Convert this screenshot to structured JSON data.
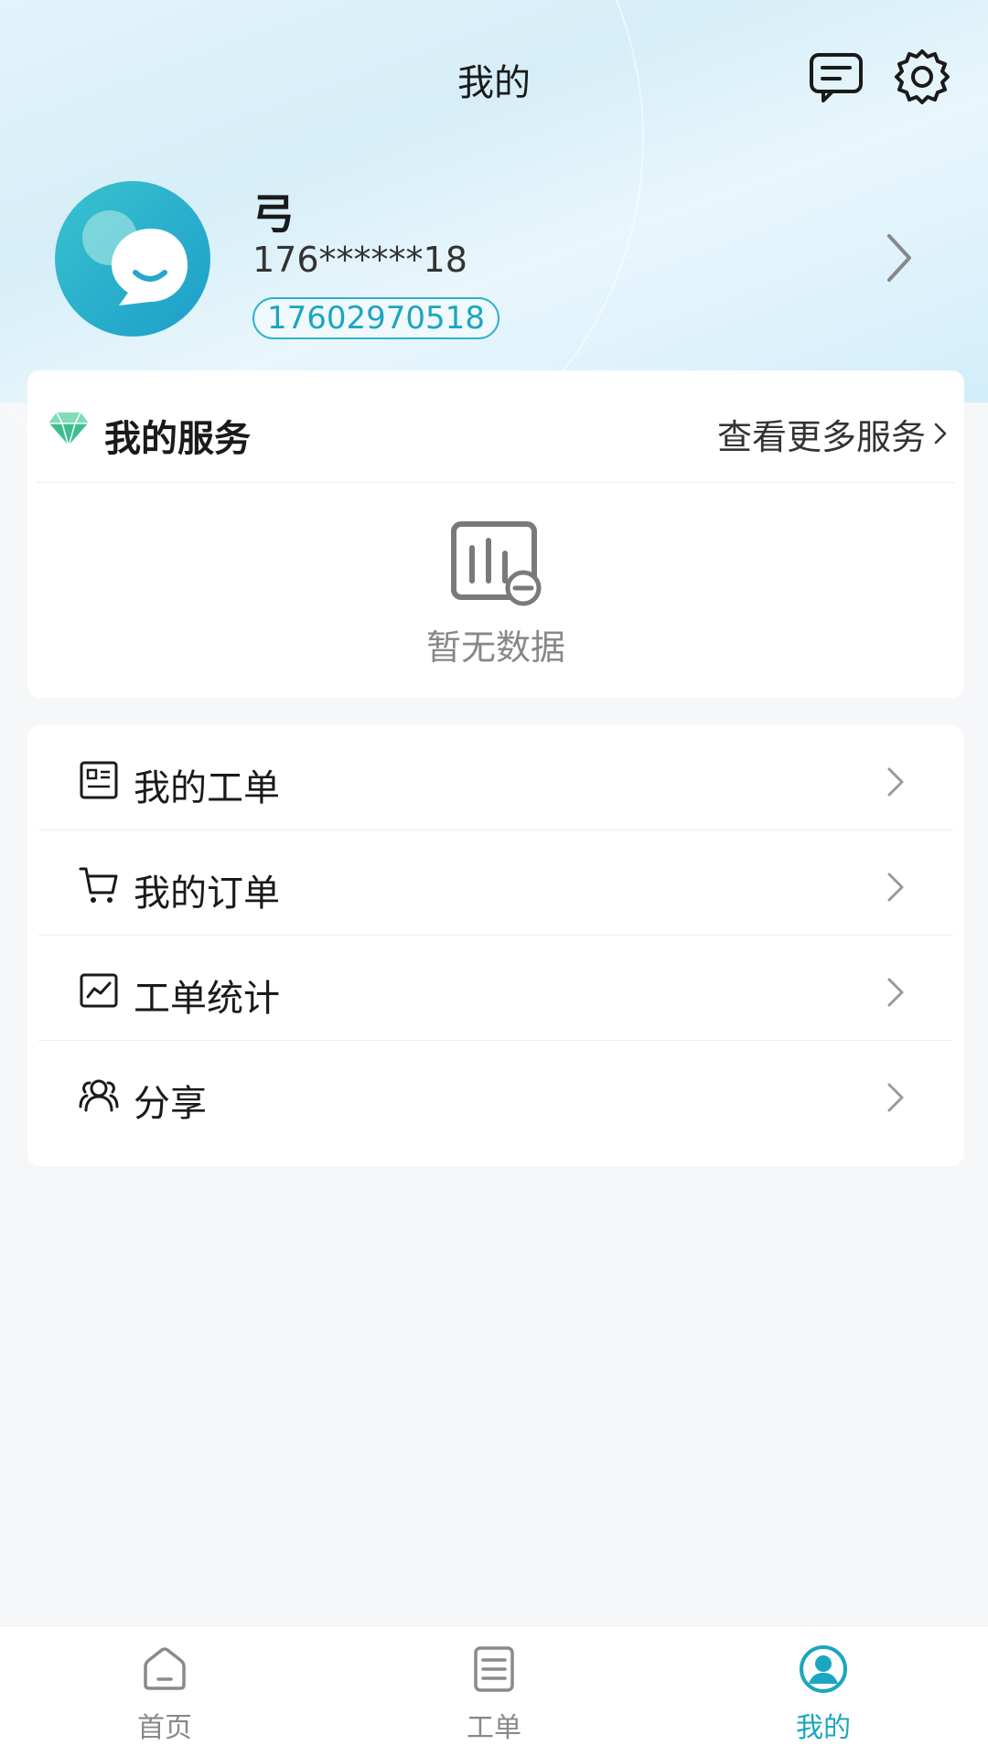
{
  "header": {
    "title": "我的",
    "message_icon": "message-icon",
    "settings_icon": "gear-icon"
  },
  "profile": {
    "name": "弓",
    "masked_phone": "176******18",
    "account_badge": "17602970518",
    "avatar_icon": "chat-bubble-avatar"
  },
  "services": {
    "title": "我的服务",
    "more_label": "查看更多服务",
    "empty_text": "暂无数据",
    "title_icon": "diamond-icon",
    "empty_icon": "no-data-chart-icon"
  },
  "menu": {
    "items": [
      {
        "label": "我的工单",
        "icon": "ticket-icon"
      },
      {
        "label": "我的订单",
        "icon": "cart-icon"
      },
      {
        "label": "工单统计",
        "icon": "stats-chart-icon"
      },
      {
        "label": "分享",
        "icon": "share-people-icon"
      }
    ]
  },
  "tabbar": {
    "tabs": [
      {
        "label": "首页",
        "icon": "home-icon",
        "active": false
      },
      {
        "label": "工单",
        "icon": "document-icon",
        "active": false
      },
      {
        "label": "我的",
        "icon": "profile-icon",
        "active": true
      }
    ]
  },
  "colors": {
    "accent": "#1aa6c0",
    "diamond": "#3cbf8f",
    "background": "#f6f7f8"
  }
}
